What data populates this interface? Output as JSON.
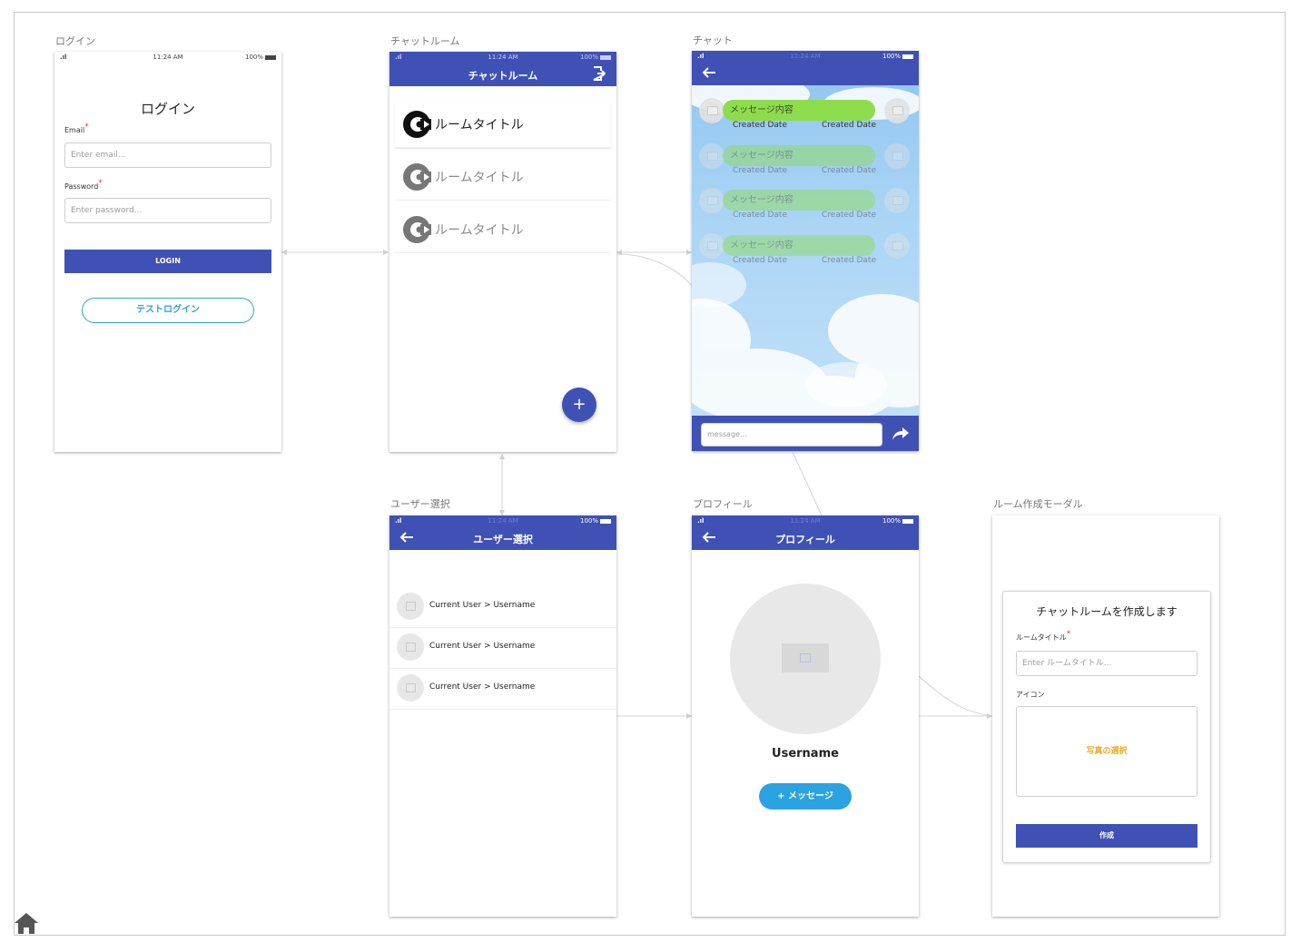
{
  "status": {
    "time": "11:24 AM",
    "battery": "100%"
  },
  "login": {
    "caption": "ログイン",
    "heading": "ログイン",
    "email_label": "Email",
    "email_placeholder": "Enter email...",
    "password_label": "Password",
    "password_placeholder": "Enter password...",
    "login_button": "LOGIN",
    "test_login_button": "テストログイン"
  },
  "rooms": {
    "caption": "チャットルーム",
    "title": "チャットルーム",
    "items": [
      {
        "label": "ルームタイトル"
      },
      {
        "label": "ルームタイトル"
      },
      {
        "label": "ルームタイトル"
      }
    ],
    "fab_label": "+"
  },
  "chat": {
    "caption": "チャット",
    "messages": [
      {
        "text": "メッセージ内容",
        "date_left": "Created Date",
        "date_right": "Created Date"
      },
      {
        "text": "メッセージ内容",
        "date_left": "Created Date",
        "date_right": "Created Date"
      },
      {
        "text": "メッセージ内容",
        "date_left": "Created Date",
        "date_right": "Created Date"
      },
      {
        "text": "メッセージ内容",
        "date_left": "Created Date",
        "date_right": "Created Date"
      }
    ],
    "input_placeholder": "message..."
  },
  "user_select": {
    "caption": "ユーザー選択",
    "title": "ユーザー選択",
    "users": [
      {
        "name": "Current User > Username"
      },
      {
        "name": "Current User > Username"
      },
      {
        "name": "Current User > Username"
      }
    ]
  },
  "profile": {
    "caption": "プロフィール",
    "title": "プロフィール",
    "username": "Username",
    "message_button": "+ メッセージ"
  },
  "modal": {
    "caption": "ルーム作成モーダル",
    "heading": "チャットルームを作成します",
    "title_label": "ルームタイトル",
    "title_placeholder": "Enter ルームタイトル...",
    "icon_label": "アイコン",
    "photo_select": "写真の選択",
    "create_button": "作成"
  },
  "colors": {
    "primary": "#3f51b5",
    "bubble": "#8ddc4b",
    "accent": "#2aa3e0",
    "photo_select": "#f5a623"
  }
}
